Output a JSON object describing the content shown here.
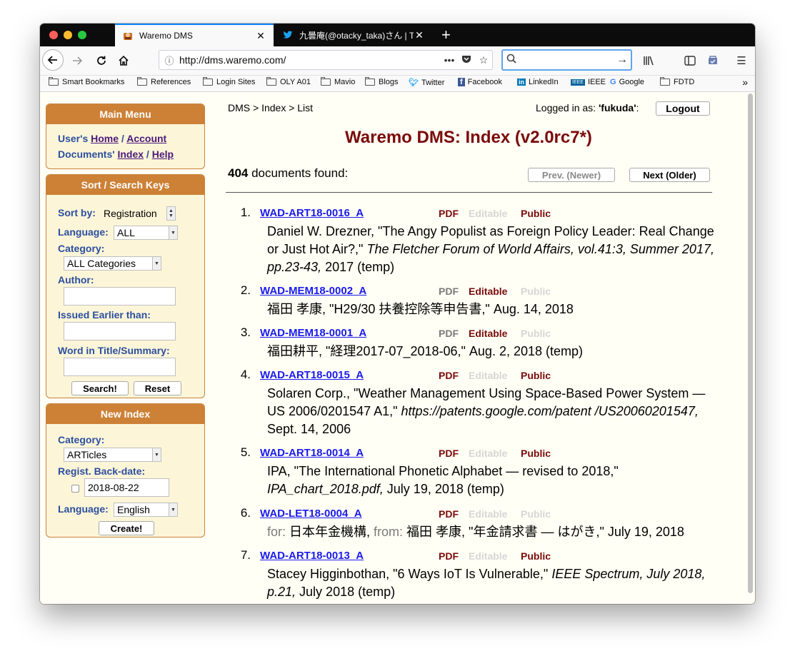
{
  "browser": {
    "tabs": [
      {
        "title": "Waremo DMS",
        "active": true
      },
      {
        "title": "九曇庵(@otacky_taka)さん | Twi",
        "active": false
      }
    ],
    "url": "http://dms.waremo.com/",
    "bookmarks": [
      "Smart Bookmarks",
      "References",
      "Login Sites",
      "OLY A01",
      "Mavio",
      "Blogs",
      "Twitter",
      "Facebook",
      "LinkedIn",
      "IEEE",
      "Google",
      "FDTD"
    ]
  },
  "header": {
    "breadcrumb": "DMS > Index > List",
    "logged_in_prefix": "Logged in as: ",
    "username": "'fukuda'",
    "logged_in_suffix": ":",
    "logout_label": "Logout",
    "title": "Waremo DMS: Index (v2.0rc7*)",
    "doc_count": "404",
    "found_label": " documents found:",
    "prev_label": "Prev. (Newer)",
    "next_label": "Next (Older)"
  },
  "sidebar": {
    "main_menu": {
      "title": "Main Menu",
      "users_prefix": "User's ",
      "home": "Home",
      "slash": " / ",
      "account": "Account",
      "documents_prefix": "Documents' ",
      "index": "Index",
      "help": "Help"
    },
    "search": {
      "title": "Sort / Search Keys",
      "sort_label": "Sort by:",
      "sort_value": "Registration",
      "language_label": "Language:",
      "language_value": "ALL",
      "category_label": "Category:",
      "category_value": "ALL Categories",
      "author_label": "Author:",
      "author_value": "",
      "issued_label": "Issued Earlier than:",
      "issued_value": "",
      "word_label": "Word in Title/Summary:",
      "word_value": "",
      "search_button": "Search!",
      "reset_button": "Reset"
    },
    "new_index": {
      "title": "New Index",
      "category_label": "Category:",
      "category_value": "ARTicles",
      "backdate_label": "Regist. Back-date:",
      "backdate_value": "2018-08-22",
      "backdate_checked": false,
      "language_label": "Language:",
      "language_value": "English",
      "create_button": "Create!"
    }
  },
  "flag_labels": {
    "pdf": "PDF",
    "editable": "Editable",
    "public": "Public"
  },
  "documents": [
    {
      "num": "1.",
      "id": "WAD-ART18-0016_A",
      "pdf": true,
      "editable": false,
      "public": true,
      "text_a": "Daniel W. Drezner, \"The Angy Populist as Foreign Policy Leader: Real Change or Just Hot Air?,\" ",
      "ital": "The Fletcher Forum of World Affairs, vol.41:3, Summer 2017, pp.23-43,",
      "text_b": " 2017 (temp)"
    },
    {
      "num": "2.",
      "id": "WAD-MEM18-0002_A",
      "pdf": false,
      "editable": true,
      "public": false,
      "text_a": "福田 孝康, \"H29/30 扶養控除等申告書,\" Aug. 14, 2018",
      "ital": "",
      "text_b": ""
    },
    {
      "num": "3.",
      "id": "WAD-MEM18-0001_A",
      "pdf": false,
      "editable": true,
      "public": false,
      "text_a": "福田耕平, \"経理2017-07_2018-06,\" Aug. 2, 2018 (temp)",
      "ital": "",
      "text_b": ""
    },
    {
      "num": "4.",
      "id": "WAD-ART18-0015_A",
      "pdf": true,
      "editable": false,
      "public": true,
      "text_a": "Solaren Corp., \"Weather Management Using Space-Based Power System — US 2006/0201547 A1,\" ",
      "ital": "https://patents.google.com/patent /US20060201547,",
      "text_b": " Sept. 14, 2006"
    },
    {
      "num": "5.",
      "id": "WAD-ART18-0014_A",
      "pdf": true,
      "editable": false,
      "public": true,
      "text_a": "IPA, \"The International Phonetic Alphabet — revised to 2018,\" ",
      "ital": "IPA_chart_2018.pdf,",
      "text_b": " July 19, 2018 (temp)"
    },
    {
      "num": "6.",
      "id": "WAD-LET18-0004_A",
      "pdf": true,
      "editable": false,
      "public": false,
      "for_label": "for: ",
      "for_value": "日本年金機構, ",
      "from_label": "from: ",
      "text_a": "福田 孝康, \"年金請求書 — はがき,\" July 19, 2018",
      "ital": "",
      "text_b": ""
    },
    {
      "num": "7.",
      "id": "WAD-ART18-0013_A",
      "pdf": true,
      "editable": false,
      "public": true,
      "text_a": "Stacey Higginbothan, \"6 Ways IoT Is Vulnerable,\" ",
      "ital": "IEEE Spectrum, July 2018, p.21,",
      "text_b": " July 2018 (temp)"
    }
  ]
}
